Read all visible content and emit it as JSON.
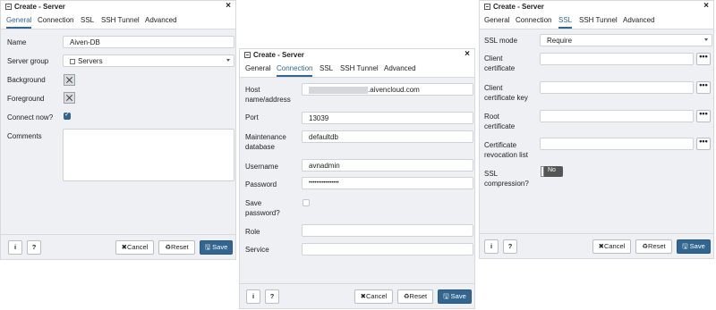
{
  "dialog1": {
    "title": "Create - Server",
    "close": "×",
    "tabs": [
      "General",
      "Connection",
      "SSL",
      "SSH Tunnel",
      "Advanced"
    ],
    "active_tab": "General",
    "fields": {
      "name_label": "Name",
      "name_value": "Aiven-DB",
      "server_group_label": "Server group",
      "server_group_value": "Servers",
      "background_label": "Background",
      "foreground_label": "Foreground",
      "connect_now_label": "Connect now?",
      "comments_label": "Comments"
    },
    "footer": {
      "info": "i",
      "help": "?",
      "cancel": "✖Cancel",
      "reset": "♻Reset",
      "save": "🖫 Save"
    }
  },
  "dialog2": {
    "title": "Create - Server",
    "close": "×",
    "tabs": [
      "General",
      "Connection",
      "SSL",
      "SSH Tunnel",
      "Advanced"
    ],
    "active_tab": "Connection",
    "fields": {
      "host_label_1": "Host",
      "host_label_2": "name/address",
      "host_value": ".aivencloud.com",
      "port_label": "Port",
      "port_value": "13039",
      "maintenance_label_1": "Maintenance",
      "maintenance_label_2": "database",
      "maintenance_value": "defaultdb",
      "username_label": "Username",
      "username_value": "avnadmin",
      "password_label": "Password",
      "password_value": "••••••••••••••••",
      "save_password_label_1": "Save",
      "save_password_label_2": "password?",
      "role_label": "Role",
      "service_label": "Service"
    },
    "footer": {
      "info": "i",
      "help": "?",
      "cancel": "✖Cancel",
      "reset": "♻Reset",
      "save": "🖫 Save"
    }
  },
  "dialog3": {
    "title": "Create - Server",
    "close": "×",
    "tabs": [
      "General",
      "Connection",
      "SSL",
      "SSH Tunnel",
      "Advanced"
    ],
    "active_tab": "SSL",
    "fields": {
      "ssl_mode_label": "SSL mode",
      "ssl_mode_value": "Require",
      "client_cert_label_1": "Client",
      "client_cert_label_2": "certificate",
      "client_key_label_1": "Client",
      "client_key_label_2": "certificate key",
      "root_cert_label_1": "Root",
      "root_cert_label_2": "certificate",
      "crl_label_1": "Certificate",
      "crl_label_2": "revocation list",
      "ssl_compression_label_1": "SSL",
      "ssl_compression_label_2": "compression?",
      "ssl_compression_value": "No",
      "browse": "•••"
    },
    "footer": {
      "info": "i",
      "help": "?",
      "cancel": "✖Cancel",
      "reset": "♻Reset",
      "save": "🖫 Save"
    }
  },
  "colors": {
    "accent": "#326690",
    "panel": "#eef0f4",
    "border": "#d6d9de"
  }
}
